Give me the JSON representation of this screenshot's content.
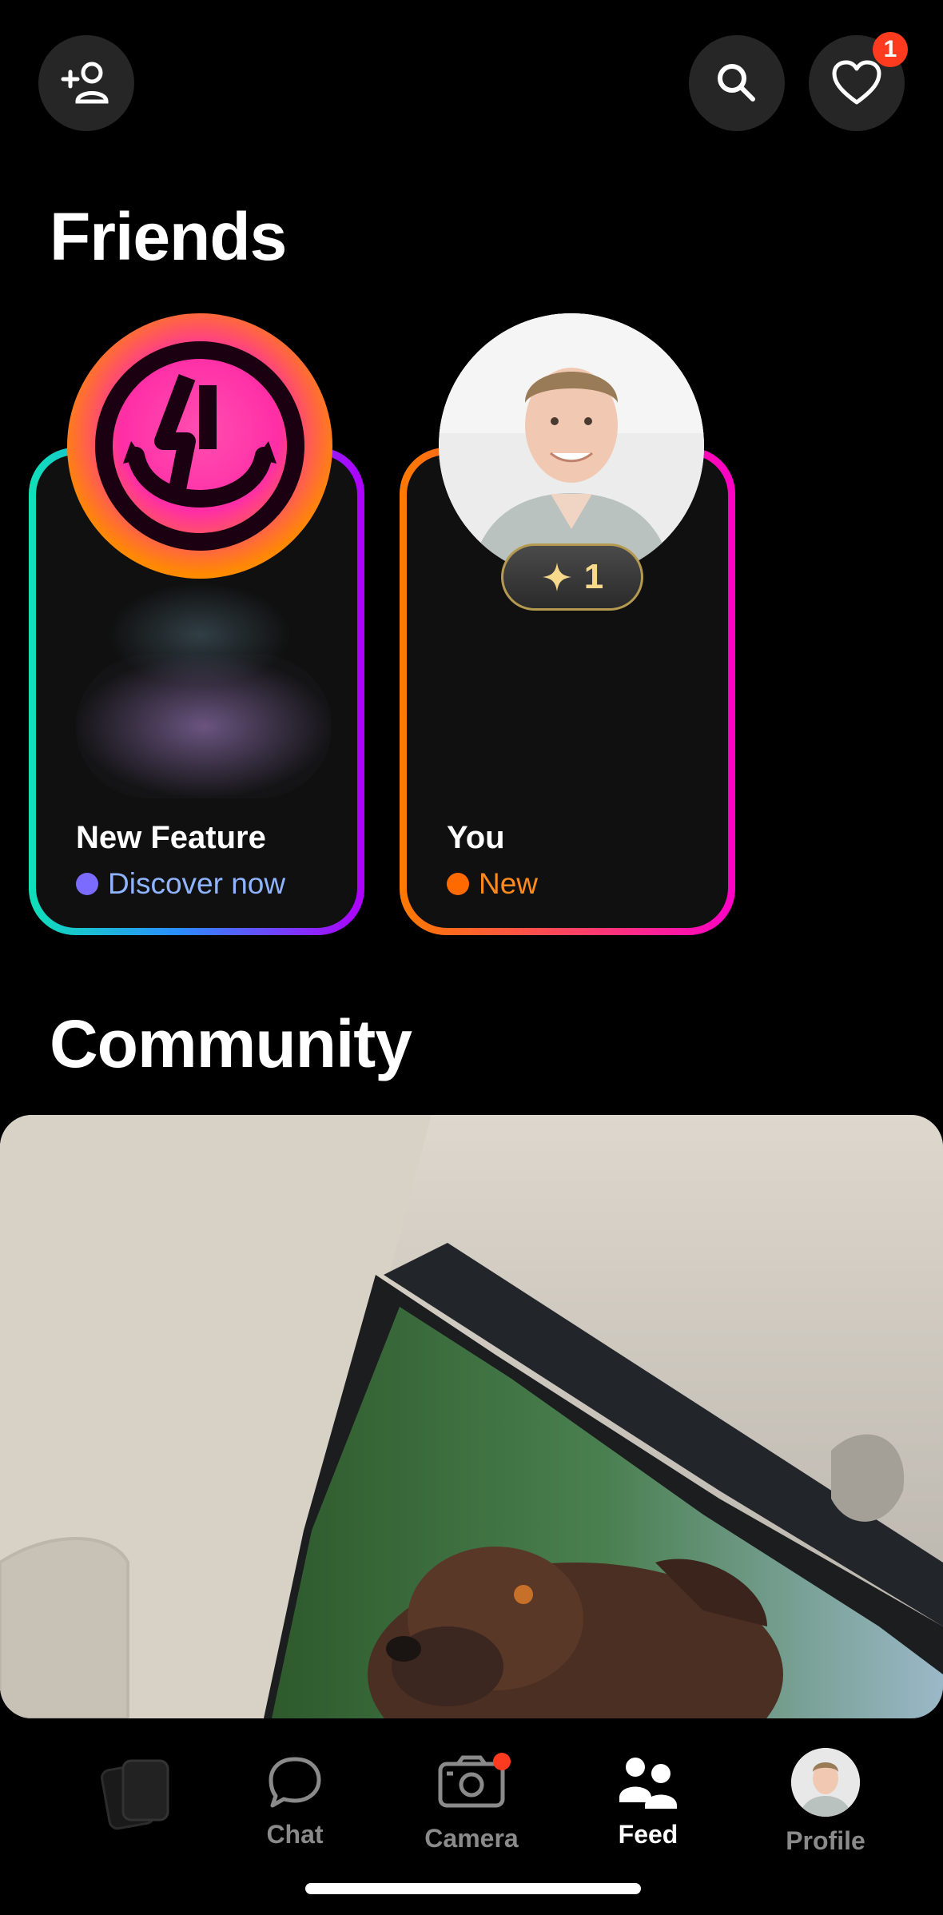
{
  "header": {
    "add_friend_icon": "add-person-icon",
    "search_icon": "search-icon",
    "activity_icon": "heart-icon",
    "activity_badge": "1"
  },
  "friends": {
    "title": "Friends",
    "cards": [
      {
        "title": "New Feature",
        "subtitle": "Discover now",
        "dot_color": "#7b6cff",
        "subtitle_color": "#8fb4ff"
      },
      {
        "title": "You",
        "subtitle": "New",
        "dot_color": "#ff6a00",
        "subtitle_color": "#ff8a1c",
        "points": "1"
      }
    ]
  },
  "community": {
    "title": "Community"
  },
  "tabbar": {
    "tabs": [
      {
        "label": "",
        "icon": "cards-icon"
      },
      {
        "label": "Chat",
        "icon": "chat-bubble-icon"
      },
      {
        "label": "Camera",
        "icon": "camera-icon"
      },
      {
        "label": "Feed",
        "icon": "people-icon",
        "active": true
      },
      {
        "label": "Profile",
        "icon": "avatar"
      }
    ]
  },
  "colors": {
    "background": "#000000",
    "badge": "#ff3b1f",
    "accent_orange": "#ff7a00",
    "accent_pink": "#ff00c8"
  }
}
